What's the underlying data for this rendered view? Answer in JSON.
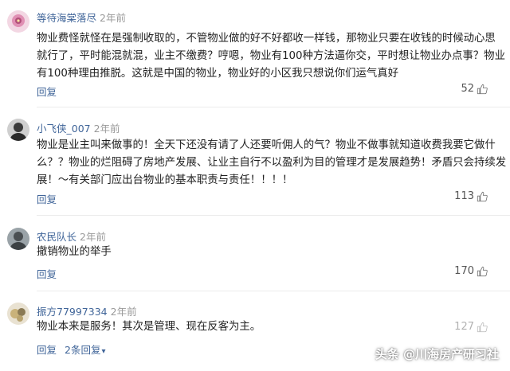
{
  "comments": [
    {
      "username": "等待海棠落尽",
      "time": "2年前",
      "lines": [
        "物业费怪就怪在是强制收取的，不管物业做的好不好都收一样钱，那物业只要在收钱的时候动心思",
        "就行了，平时能混就混，业主不缴费？哼嗯，物业有100种方法逼你交，平时想让物业办点事？物业",
        "有100种理由推脱。这就是中国的物业，物业好的小区我只想说你们运气真好"
      ],
      "reply_label": "回复",
      "likes": "52"
    },
    {
      "username": "小飞侠_007",
      "time": "2年前",
      "lines": [
        "物业是业主叫来做事的！全天下还没有请了人还要听佣人的气？物业不做事就知道收费我要它做什",
        "么？？物业的烂阻碍了房地产发展、让业主自行不以盈利为目的管理才是发展趋势！矛盾只会持续发",
        "展！～有关部门应出台物业的基本职责与责任！！！！"
      ],
      "reply_label": "回复",
      "likes": "113"
    },
    {
      "username": "农民队长",
      "time": "2年前",
      "lines": [
        "撤销物业的举手"
      ],
      "reply_label": "回复",
      "likes": "170"
    },
    {
      "username": "振方77997334",
      "time": "2年前",
      "lines": [
        "物业本来是服务！其次是管理、现在反客为主。"
      ],
      "reply_label": "回复",
      "reply_count_label": "2条回复",
      "likes": "127"
    }
  ],
  "watermark": {
    "text": "头条 @川海房产研习社"
  },
  "colors": {
    "username": "#406599",
    "time": "#9a9a9a",
    "reply": "#406599",
    "text": "#222222"
  }
}
